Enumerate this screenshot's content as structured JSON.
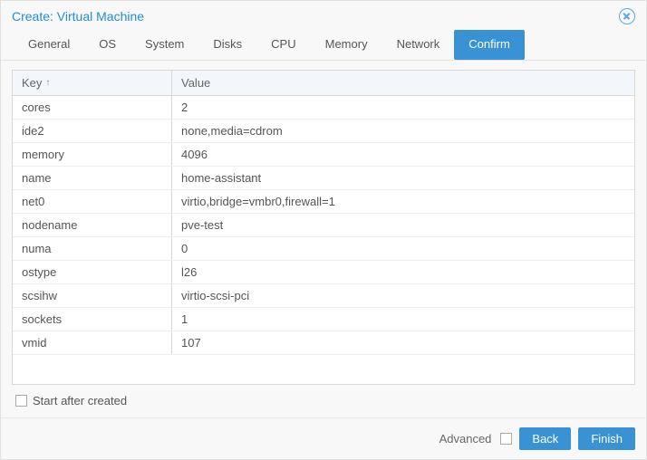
{
  "colors": {
    "accent": "#3892d4",
    "link": "#1e90d4"
  },
  "dialog": {
    "title": "Create: Virtual Machine"
  },
  "tabs": [
    {
      "id": "general",
      "label": "General",
      "active": false
    },
    {
      "id": "os",
      "label": "OS",
      "active": false
    },
    {
      "id": "system",
      "label": "System",
      "active": false
    },
    {
      "id": "disks",
      "label": "Disks",
      "active": false
    },
    {
      "id": "cpu",
      "label": "CPU",
      "active": false
    },
    {
      "id": "memory",
      "label": "Memory",
      "active": false
    },
    {
      "id": "network",
      "label": "Network",
      "active": false
    },
    {
      "id": "confirm",
      "label": "Confirm",
      "active": true
    }
  ],
  "columns": {
    "key": "Key",
    "value": "Value",
    "sort": "asc"
  },
  "rows": [
    {
      "key": "cores",
      "value": "2"
    },
    {
      "key": "ide2",
      "value": "none,media=cdrom"
    },
    {
      "key": "memory",
      "value": "4096"
    },
    {
      "key": "name",
      "value": "home-assistant"
    },
    {
      "key": "net0",
      "value": "virtio,bridge=vmbr0,firewall=1"
    },
    {
      "key": "nodename",
      "value": "pve-test"
    },
    {
      "key": "numa",
      "value": "0"
    },
    {
      "key": "ostype",
      "value": "l26"
    },
    {
      "key": "scsihw",
      "value": "virtio-scsi-pci"
    },
    {
      "key": "sockets",
      "value": "1"
    },
    {
      "key": "vmid",
      "value": "107"
    }
  ],
  "start_after": {
    "label": "Start after created",
    "checked": false
  },
  "footer": {
    "advanced_label": "Advanced",
    "advanced_checked": false,
    "back": "Back",
    "finish": "Finish"
  }
}
